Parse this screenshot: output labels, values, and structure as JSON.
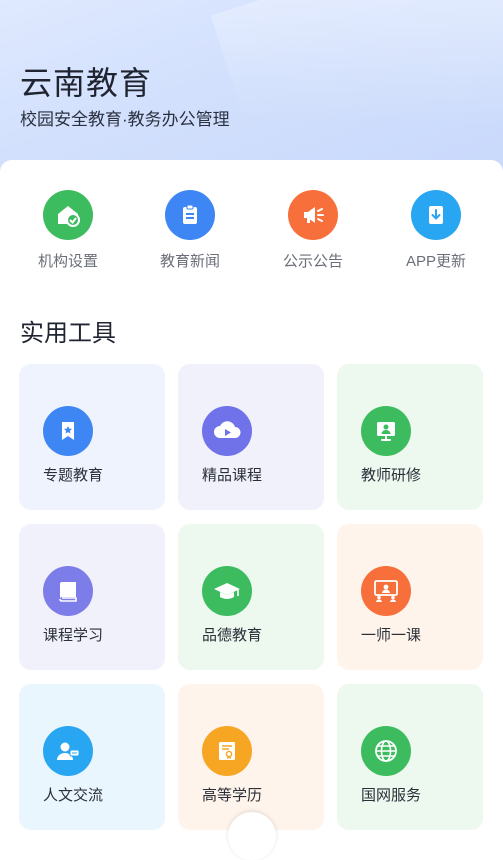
{
  "header": {
    "title": "云南教育",
    "subtitle": "校园安全教育·教务办公管理"
  },
  "quick_actions": [
    {
      "label": "机构设置",
      "icon": "house-check-icon",
      "color": "#3dbb5f"
    },
    {
      "label": "教育新闻",
      "icon": "clipboard-icon",
      "color": "#3f86f5"
    },
    {
      "label": "公示公告",
      "icon": "megaphone-icon",
      "color": "#f7703b"
    },
    {
      "label": "APP更新",
      "icon": "download-icon",
      "color": "#29a6f2"
    }
  ],
  "tools": {
    "title": "实用工具",
    "items": [
      {
        "label": "专题教育",
        "icon": "bookmark-star-icon",
        "color": "#3f86f5",
        "bg": "#eef3fd"
      },
      {
        "label": "精品课程",
        "icon": "cloud-play-icon",
        "color": "#6f72e8",
        "bg": "#f1f1fc"
      },
      {
        "label": "教师研修",
        "icon": "teacher-screen-icon",
        "color": "#3dbb5f",
        "bg": "#edf8ef"
      },
      {
        "label": "课程学习",
        "icon": "book-icon",
        "color": "#7d7de9",
        "bg": "#f1f1fc"
      },
      {
        "label": "品德教育",
        "icon": "graduation-cap-icon",
        "color": "#3dbb5f",
        "bg": "#edf8ef"
      },
      {
        "label": "一师一课",
        "icon": "lecture-board-icon",
        "color": "#f7703b",
        "bg": "#fff4eb"
      },
      {
        "label": "人文交流",
        "icon": "user-chat-icon",
        "color": "#29a6f2",
        "bg": "#eaf6fd"
      },
      {
        "label": "高等学历",
        "icon": "certificate-icon",
        "color": "#f7a623",
        "bg": "#fff4eb"
      },
      {
        "label": "国网服务",
        "icon": "globe-icon",
        "color": "#3dbb5f",
        "bg": "#edf8ef"
      }
    ]
  }
}
